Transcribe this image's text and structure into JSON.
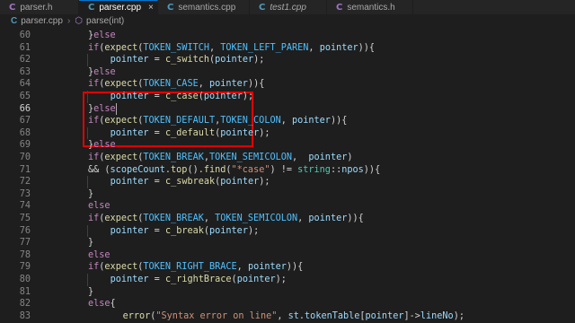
{
  "tabs": [
    {
      "label": "parser.h",
      "kind": "h",
      "active": false,
      "italic": false
    },
    {
      "label": "parser.cpp",
      "kind": "cpp",
      "active": true,
      "italic": false,
      "close": "×"
    },
    {
      "label": "semantics.cpp",
      "kind": "cpp",
      "active": false,
      "italic": false
    },
    {
      "label": "test1.cpp",
      "kind": "cpp",
      "active": false,
      "italic": true
    },
    {
      "label": "semantics.h",
      "kind": "h",
      "active": false,
      "italic": false
    }
  ],
  "breadcrumb": {
    "file": "parser.cpp",
    "symbol": "parse(int)"
  },
  "lines": [
    {
      "n": "60",
      "tokens": [
        [
          "p",
          "}"
        ],
        [
          "k",
          "else"
        ]
      ]
    },
    {
      "n": "61",
      "tokens": [
        [
          "k",
          "if"
        ],
        [
          "p",
          "("
        ],
        [
          "f",
          "expect"
        ],
        [
          "p",
          "("
        ],
        [
          "c",
          "TOKEN_SWITCH"
        ],
        [
          "p",
          ", "
        ],
        [
          "c",
          "TOKEN_LEFT_PAREN"
        ],
        [
          "p",
          ", "
        ],
        [
          "v",
          "pointer"
        ],
        [
          "p",
          "))"
        ],
        [
          "p",
          "{"
        ]
      ]
    },
    {
      "n": "62",
      "indent": 1,
      "tokens": [
        [
          "v",
          "pointer"
        ],
        [
          "p",
          " = "
        ],
        [
          "f",
          "c_switch"
        ],
        [
          "p",
          "("
        ],
        [
          "v",
          "pointer"
        ],
        [
          "p",
          ");"
        ]
      ]
    },
    {
      "n": "63",
      "tokens": [
        [
          "p",
          "}"
        ],
        [
          "k",
          "else"
        ]
      ]
    },
    {
      "n": "64",
      "tokens": [
        [
          "k",
          "if"
        ],
        [
          "p",
          "("
        ],
        [
          "f",
          "expect"
        ],
        [
          "p",
          "("
        ],
        [
          "c",
          "TOKEN_CASE"
        ],
        [
          "p",
          ", "
        ],
        [
          "v",
          "pointer"
        ],
        [
          "p",
          "))"
        ],
        [
          "p",
          "{"
        ]
      ]
    },
    {
      "n": "65",
      "indent": 1,
      "tokens": [
        [
          "v",
          "pointer"
        ],
        [
          "p",
          " = "
        ],
        [
          "f",
          "c_case"
        ],
        [
          "p",
          "("
        ],
        [
          "v",
          "pointer"
        ],
        [
          "p",
          ");"
        ]
      ]
    },
    {
      "n": "66",
      "tokens": [
        [
          "p",
          "}"
        ],
        [
          "k",
          "else"
        ]
      ]
    },
    {
      "n": "67",
      "tokens": [
        [
          "k",
          "if"
        ],
        [
          "p",
          "("
        ],
        [
          "f",
          "expect"
        ],
        [
          "p",
          "("
        ],
        [
          "c",
          "TOKEN_DEFAULT"
        ],
        [
          "p",
          ","
        ],
        [
          "c",
          "TOKEN_COLON"
        ],
        [
          "p",
          ", "
        ],
        [
          "v",
          "pointer"
        ],
        [
          "p",
          "))"
        ],
        [
          "p",
          "{"
        ]
      ]
    },
    {
      "n": "68",
      "indent": 1,
      "tokens": [
        [
          "v",
          "pointer"
        ],
        [
          "p",
          " = "
        ],
        [
          "f",
          "c_default"
        ],
        [
          "p",
          "("
        ],
        [
          "v",
          "pointer"
        ],
        [
          "p",
          ");"
        ]
      ]
    },
    {
      "n": "69",
      "tokens": [
        [
          "p",
          "}"
        ],
        [
          "k",
          "else"
        ]
      ]
    },
    {
      "n": "70",
      "tokens": [
        [
          "k",
          "if"
        ],
        [
          "p",
          "("
        ],
        [
          "f",
          "expect"
        ],
        [
          "p",
          "("
        ],
        [
          "c",
          "TOKEN_BREAK"
        ],
        [
          "p",
          ","
        ],
        [
          "c",
          "TOKEN_SEMICOLON"
        ],
        [
          "p",
          ",  "
        ],
        [
          "v",
          "pointer"
        ],
        [
          "p",
          ")"
        ]
      ]
    },
    {
      "n": "71",
      "tokens": [
        [
          "p",
          "&& ("
        ],
        [
          "v",
          "scopeCount"
        ],
        [
          "p",
          "."
        ],
        [
          "f",
          "top"
        ],
        [
          "p",
          "()."
        ],
        [
          "f",
          "find"
        ],
        [
          "p",
          "("
        ],
        [
          "s",
          "\"*case\""
        ],
        [
          "p",
          ") != "
        ],
        [
          "t",
          "string"
        ],
        [
          "p",
          "::"
        ],
        [
          "v",
          "npos"
        ],
        [
          "p",
          "))"
        ],
        [
          "p",
          "{"
        ]
      ]
    },
    {
      "n": "72",
      "indent": 1,
      "tokens": [
        [
          "v",
          "pointer"
        ],
        [
          "p",
          " = "
        ],
        [
          "f",
          "c_swbreak"
        ],
        [
          "p",
          "("
        ],
        [
          "v",
          "pointer"
        ],
        [
          "p",
          ");"
        ]
      ]
    },
    {
      "n": "73",
      "tokens": [
        [
          "p",
          "}"
        ]
      ]
    },
    {
      "n": "74",
      "tokens": [
        [
          "k",
          "else"
        ]
      ]
    },
    {
      "n": "75",
      "tokens": [
        [
          "k",
          "if"
        ],
        [
          "p",
          "("
        ],
        [
          "f",
          "expect"
        ],
        [
          "p",
          "("
        ],
        [
          "c",
          "TOKEN_BREAK"
        ],
        [
          "p",
          ", "
        ],
        [
          "c",
          "TOKEN_SEMICOLON"
        ],
        [
          "p",
          ", "
        ],
        [
          "v",
          "pointer"
        ],
        [
          "p",
          "))"
        ],
        [
          "p",
          "{"
        ]
      ]
    },
    {
      "n": "76",
      "indent": 1,
      "tokens": [
        [
          "v",
          "pointer"
        ],
        [
          "p",
          " = "
        ],
        [
          "f",
          "c_break"
        ],
        [
          "p",
          "("
        ],
        [
          "v",
          "pointer"
        ],
        [
          "p",
          ");"
        ]
      ]
    },
    {
      "n": "77",
      "tokens": [
        [
          "p",
          "}"
        ]
      ]
    },
    {
      "n": "78",
      "tokens": [
        [
          "k",
          "else"
        ]
      ]
    },
    {
      "n": "79",
      "tokens": [
        [
          "k",
          "if"
        ],
        [
          "p",
          "("
        ],
        [
          "f",
          "expect"
        ],
        [
          "p",
          "("
        ],
        [
          "c",
          "TOKEN_RIGHT_BRACE"
        ],
        [
          "p",
          ", "
        ],
        [
          "v",
          "pointer"
        ],
        [
          "p",
          "))"
        ],
        [
          "p",
          "{"
        ]
      ]
    },
    {
      "n": "80",
      "indent": 1,
      "tokens": [
        [
          "v",
          "pointer"
        ],
        [
          "p",
          " = "
        ],
        [
          "f",
          "c_rightBrace"
        ],
        [
          "p",
          "("
        ],
        [
          "v",
          "pointer"
        ],
        [
          "p",
          ");"
        ]
      ]
    },
    {
      "n": "81",
      "tokens": [
        [
          "p",
          "}"
        ]
      ]
    },
    {
      "n": "82",
      "tokens": [
        [
          "k",
          "else"
        ],
        [
          "p",
          "{"
        ]
      ]
    },
    {
      "n": "83",
      "indent": 2,
      "tokens": [
        [
          "f",
          "error"
        ],
        [
          "p",
          "("
        ],
        [
          "s",
          "\"Syntax error on line\""
        ],
        [
          "p",
          ", "
        ],
        [
          "v",
          "st"
        ],
        [
          "p",
          "."
        ],
        [
          "v",
          "tokenTable"
        ],
        [
          "p",
          "["
        ],
        [
          "v",
          "pointer"
        ],
        [
          "p",
          "]->"
        ],
        [
          "v",
          "lineNo"
        ],
        [
          "p",
          ");"
        ]
      ]
    }
  ],
  "current_line": "66",
  "colors": {
    "highlight": "#e00000",
    "keyword": "#c586c0",
    "function": "#dcdcaa",
    "constant": "#4fc1ff",
    "variable": "#9cdcfe",
    "string": "#ce9178",
    "type": "#4ec9b0"
  },
  "icons": {
    "cpp_file": "C",
    "h_file": "C",
    "symbol": "⬡"
  }
}
